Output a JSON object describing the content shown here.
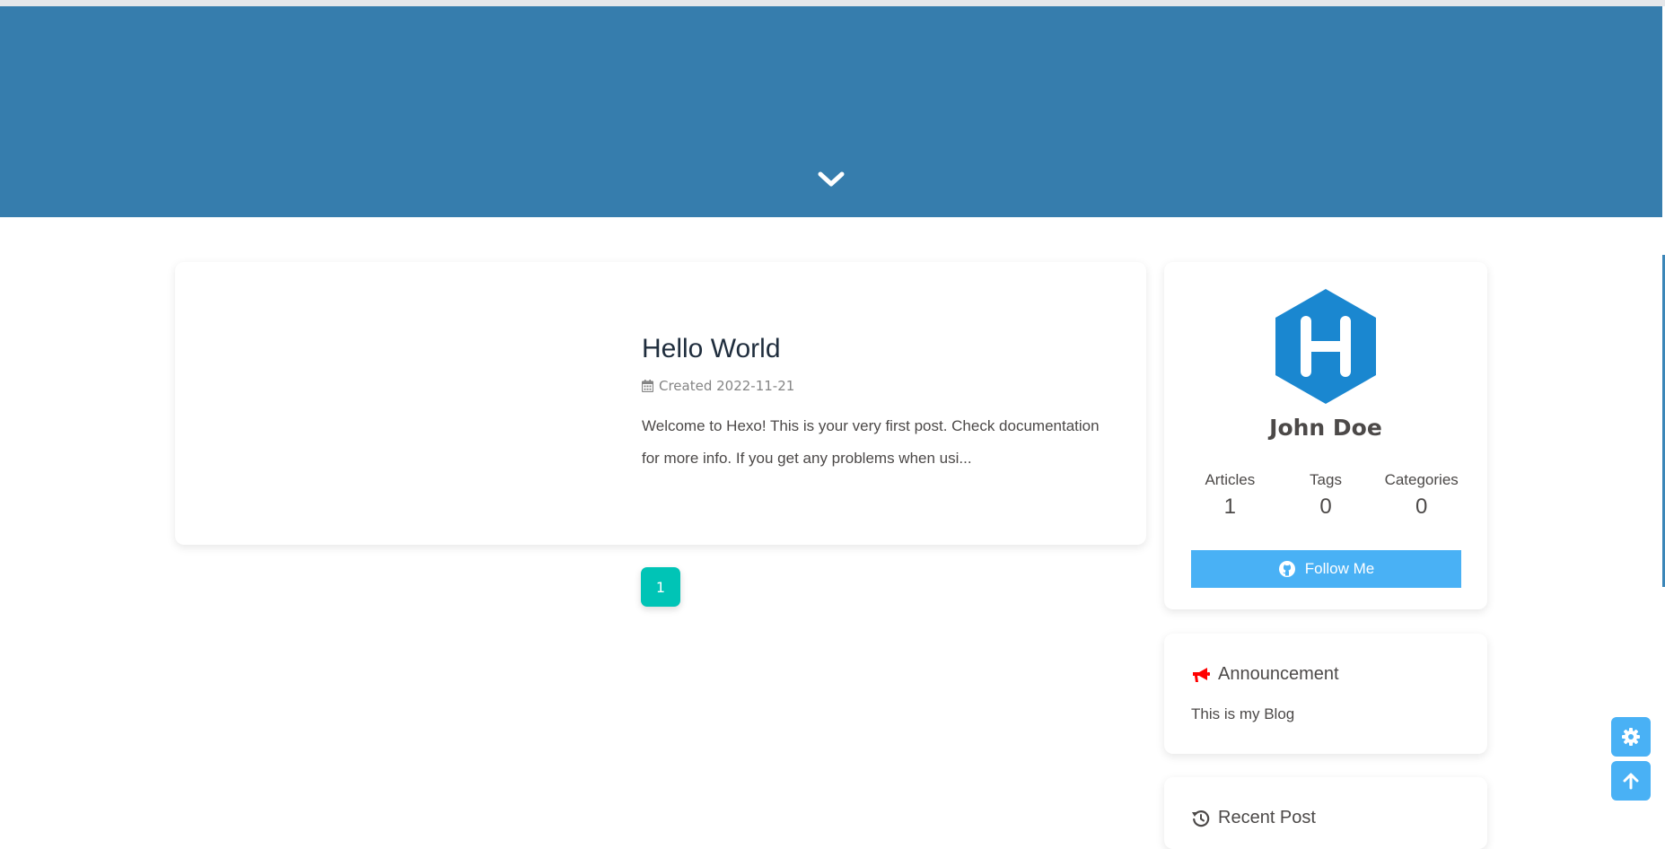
{
  "post": {
    "title": "Hello World",
    "meta_created": "Created 2022-11-21",
    "excerpt": "Welcome to Hexo! This is your very first post. Check documentation for more info. If you get any problems when usi..."
  },
  "pagination": {
    "current_page": "1"
  },
  "author": {
    "avatar_letter": "H",
    "name": "John Doe",
    "stats": [
      {
        "label": "Articles",
        "value": "1"
      },
      {
        "label": "Tags",
        "value": "0"
      },
      {
        "label": "Categories",
        "value": "0"
      }
    ],
    "follow_label": "Follow Me"
  },
  "announcement": {
    "title": "Announcement",
    "text": "This is my Blog"
  },
  "recent": {
    "title": "Recent Post"
  },
  "icons": {
    "scroll": "chevron-down-icon",
    "calendar": "calendar-icon",
    "github": "github-icon",
    "bullhorn": "bullhorn-icon",
    "history": "history-icon",
    "settings": "gear-icon",
    "to_top": "arrow-up-icon"
  },
  "colors": {
    "banner": "#367dad",
    "accent": "#49b1f5",
    "page_button": "#00c4b6",
    "avatar": "#1a87d0",
    "announcement_icon": "#ff0000"
  }
}
